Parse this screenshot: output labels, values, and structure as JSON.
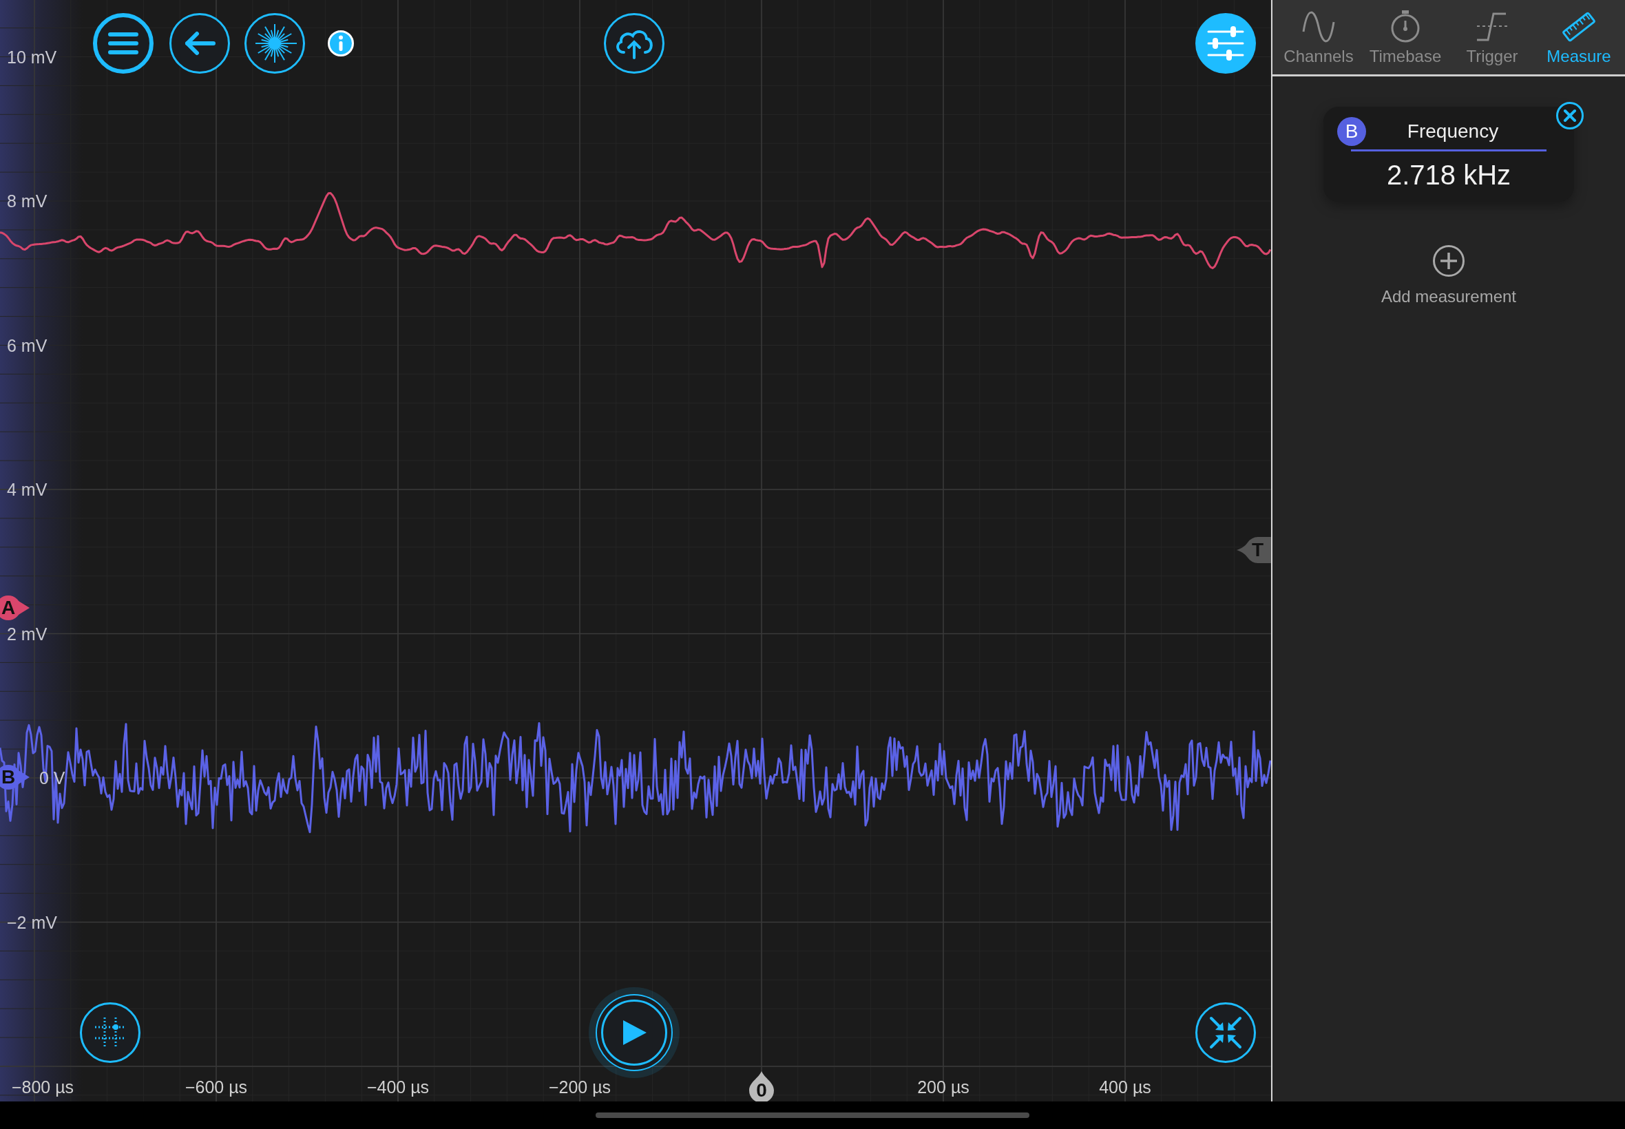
{
  "toolbar": [
    {
      "kind": "menu",
      "active": false
    },
    {
      "kind": "back",
      "active": false
    },
    {
      "kind": "laser",
      "active": false
    },
    {
      "kind": "info"
    },
    {
      "kind": "upload",
      "active": false
    },
    {
      "kind": "settings",
      "active": true
    }
  ],
  "voltage_axis": [
    {
      "text": "10 mV",
      "kind": "tick"
    },
    {
      "text": "8 mV",
      "kind": "tick"
    },
    {
      "text": "6 mV",
      "kind": "tick"
    },
    {
      "text": "4 mV",
      "kind": "tick"
    },
    {
      "text": "2 mV",
      "kind": "tick"
    },
    {
      "text": "0 V",
      "kind": "offset"
    },
    {
      "text": "−2 mV",
      "kind": "tick"
    }
  ],
  "time_axis": [
    {
      "text": "−800 µs",
      "kind": "tick"
    },
    {
      "text": "−600 µs",
      "kind": "tick"
    },
    {
      "text": "−400 µs",
      "kind": "tick"
    },
    {
      "text": "−200 µs",
      "kind": "tick"
    },
    {
      "text": "0",
      "kind": "trigger"
    },
    {
      "text": "200 µs",
      "kind": "tick"
    },
    {
      "text": "400 µs",
      "kind": "tick"
    }
  ],
  "channels": [
    {
      "label": "A",
      "color": "#d9466c"
    },
    {
      "label": "B",
      "color": "#5b62e6"
    }
  ],
  "trigger": {
    "label": "T"
  },
  "bottom_controls": [
    {
      "kind": "grid"
    },
    {
      "kind": "play"
    },
    {
      "kind": "compress"
    }
  ],
  "panel": {
    "tabs": [
      {
        "label": "Channels",
        "kind": "sine",
        "selected": false
      },
      {
        "label": "Timebase",
        "kind": "stopwatch",
        "selected": false
      },
      {
        "label": "Trigger",
        "kind": "edge",
        "selected": false
      },
      {
        "label": "Measure",
        "kind": "ruler",
        "selected": true
      }
    ],
    "measurements": [
      {
        "channel": "B",
        "color": "#5560e0",
        "name": "Frequency",
        "value": "2.718 kHz"
      }
    ],
    "add_measurement": "Add measurement"
  }
}
